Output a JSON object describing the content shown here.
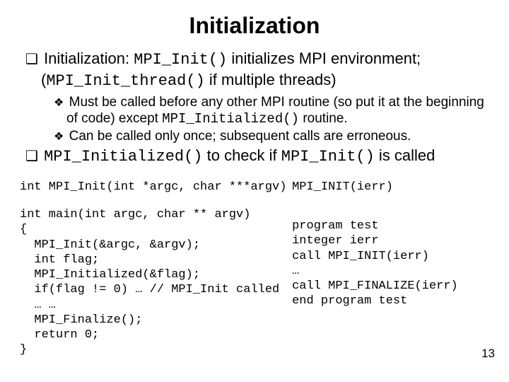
{
  "title": "Initialization",
  "b1_pre": "Initialization: ",
  "b1_code1": "MPI_Init()",
  "b1_mid": " initializes MPI environment; (",
  "b1_code2": "MPI_Init_thread()",
  "b1_post": " if multiple threads)",
  "s1_pre": "Must be called before any other MPI routine (so put it at the beginning of code) except ",
  "s1_code": "MPI_Initialized()",
  "s1_post": " routine.",
  "s2": "Can be called only once; subsequent calls are erroneous.",
  "b2_code1": "MPI_Initialized()",
  "b2_mid": " to check if ",
  "b2_code2": "MPI_Init()",
  "b2_post": " is called",
  "sig_c": "int MPI_Init(int *argc, char ***argv)",
  "sig_f": "MPI_INIT(ierr)",
  "code_c": "int main(int argc, char ** argv)\n{\n  MPI_Init(&argc, &argv);\n  int flag;\n  MPI_Initialized(&flag);\n  if(flag != 0) … // MPI_Init called\n  … …\n  MPI_Finalize();\n  return 0;\n}",
  "code_f": "program test\ninteger ierr\ncall MPI_INIT(ierr)\n…\ncall MPI_FINALIZE(ierr)\nend program test",
  "pagenum": "13"
}
